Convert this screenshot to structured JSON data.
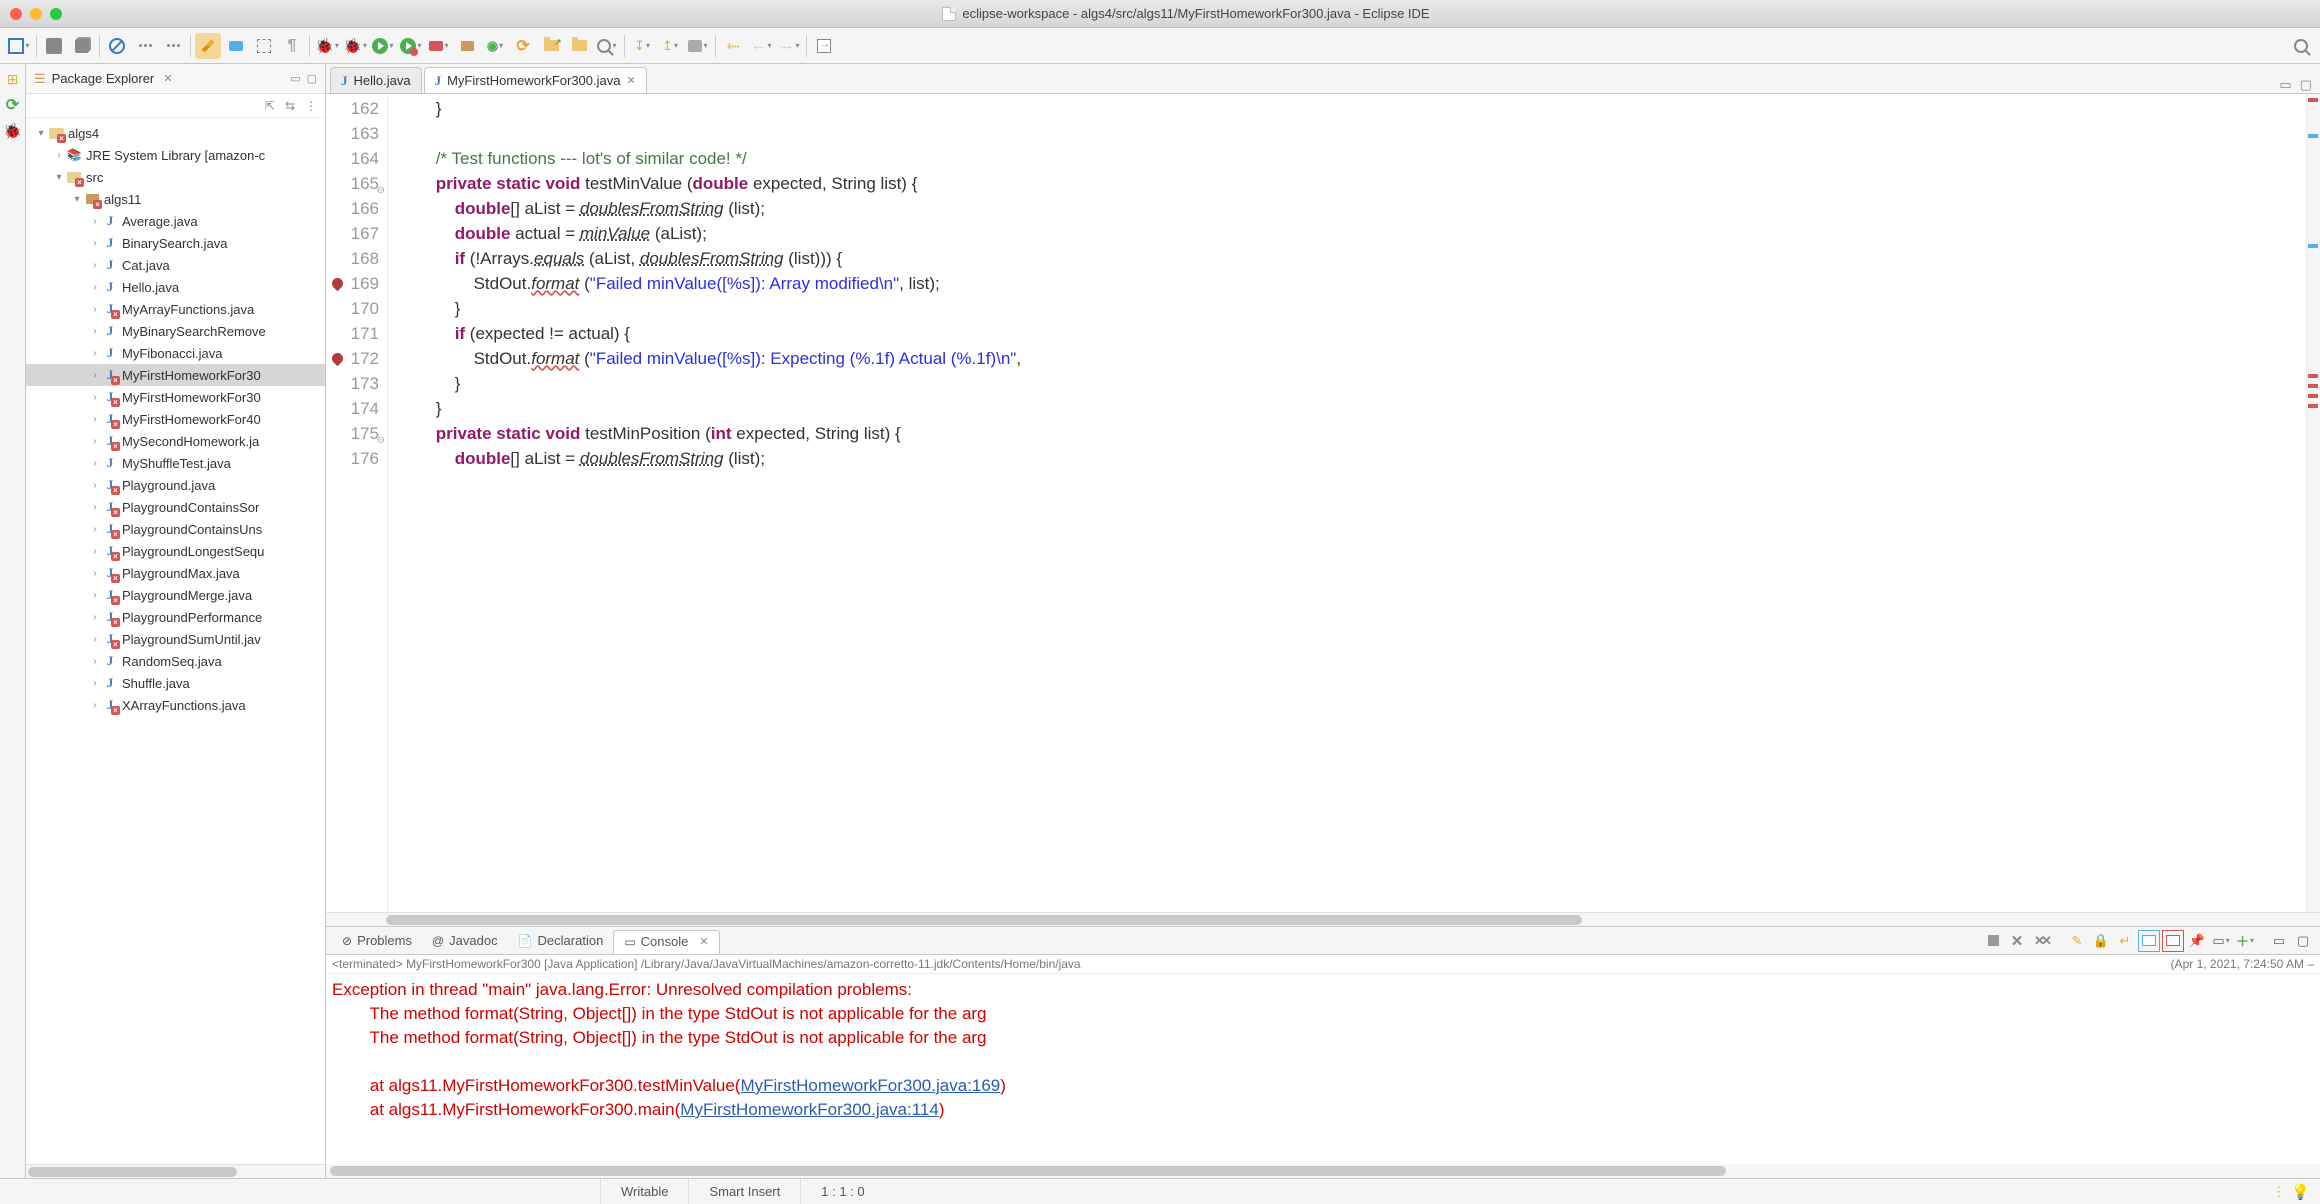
{
  "window": {
    "title": "eclipse-workspace - algs4/src/algs11/MyFirstHomeworkFor300.java - Eclipse IDE"
  },
  "pkg_explorer": {
    "title": "Package Explorer",
    "project": "algs4",
    "jre": "JRE System Library [amazon-c",
    "src": "src",
    "package": "algs11",
    "files": [
      "Average.java",
      "BinarySearch.java",
      "Cat.java",
      "Hello.java",
      "MyArrayFunctions.java",
      "MyBinarySearchRemove",
      "MyFibonacci.java",
      "MyFirstHomeworkFor30",
      "MyFirstHomeworkFor30",
      "MyFirstHomeworkFor40",
      "MySecondHomework.ja",
      "MyShuffleTest.java",
      "Playground.java",
      "PlaygroundContainsSor",
      "PlaygroundContainsUns",
      "PlaygroundLongestSequ",
      "PlaygroundMax.java",
      "PlaygroundMerge.java",
      "PlaygroundPerformance",
      "PlaygroundSumUntil.jav",
      "RandomSeq.java",
      "Shuffle.java",
      "XArrayFunctions.java"
    ],
    "selected_index": 7
  },
  "editor": {
    "tabs": [
      {
        "name": "Hello.java",
        "active": false
      },
      {
        "name": "MyFirstHomeworkFor300.java",
        "active": true
      }
    ],
    "first_line_no": 162,
    "breakpoints": [
      169,
      172
    ],
    "collapse_marks": [
      165,
      175
    ],
    "code_lines": [
      {
        "raw": "        }"
      },
      {
        "raw": ""
      },
      {
        "raw": "        /* Test functions --- lot's of similar code! */",
        "cls": "cm"
      },
      {
        "tokens": [
          {
            "t": "        "
          },
          {
            "t": "private",
            "c": "kw"
          },
          {
            "t": " "
          },
          {
            "t": "static",
            "c": "kw"
          },
          {
            "t": " "
          },
          {
            "t": "void",
            "c": "kw"
          },
          {
            "t": " testMinValue ("
          },
          {
            "t": "double",
            "c": "kw"
          },
          {
            "t": " expected, String list) {"
          }
        ]
      },
      {
        "tokens": [
          {
            "t": "            "
          },
          {
            "t": "double",
            "c": "kw"
          },
          {
            "t": "[] aList = "
          },
          {
            "t": "doublesFromString",
            "c": "fn-u"
          },
          {
            "t": " (list);"
          }
        ]
      },
      {
        "tokens": [
          {
            "t": "            "
          },
          {
            "t": "double",
            "c": "kw"
          },
          {
            "t": " actual = "
          },
          {
            "t": "minValue",
            "c": "fn-u"
          },
          {
            "t": " (aList);"
          }
        ]
      },
      {
        "tokens": [
          {
            "t": "            "
          },
          {
            "t": "if",
            "c": "kw"
          },
          {
            "t": " (!Arrays."
          },
          {
            "t": "equals",
            "c": "fn-u"
          },
          {
            "t": " (aList, "
          },
          {
            "t": "doublesFromString",
            "c": "fn-u"
          },
          {
            "t": " (list))) {"
          }
        ]
      },
      {
        "tokens": [
          {
            "t": "                StdOut."
          },
          {
            "t": "format",
            "c": "fn-u squiggle"
          },
          {
            "t": " ("
          },
          {
            "t": "\"Failed minValue([%s]): Array modified\\n\"",
            "c": "str"
          },
          {
            "t": ", list);"
          }
        ]
      },
      {
        "raw": "            }"
      },
      {
        "tokens": [
          {
            "t": "            "
          },
          {
            "t": "if",
            "c": "kw"
          },
          {
            "t": " (expected != actual) {"
          }
        ]
      },
      {
        "tokens": [
          {
            "t": "                StdOut."
          },
          {
            "t": "format",
            "c": "fn-u squiggle"
          },
          {
            "t": " ("
          },
          {
            "t": "\"Failed minValue([%s]): Expecting (%.1f) Actual (%.1f)\\n\"",
            "c": "str"
          },
          {
            "t": ","
          }
        ]
      },
      {
        "raw": "            }"
      },
      {
        "raw": "        }"
      },
      {
        "tokens": [
          {
            "t": "        "
          },
          {
            "t": "private",
            "c": "kw"
          },
          {
            "t": " "
          },
          {
            "t": "static",
            "c": "kw"
          },
          {
            "t": " "
          },
          {
            "t": "void",
            "c": "kw"
          },
          {
            "t": " testMinPosition ("
          },
          {
            "t": "int",
            "c": "kw"
          },
          {
            "t": " expected, String list) {"
          }
        ]
      },
      {
        "tokens": [
          {
            "t": "            "
          },
          {
            "t": "double",
            "c": "kw"
          },
          {
            "t": "[] aList = "
          },
          {
            "t": "doublesFromString",
            "c": "fn-u"
          },
          {
            "t": " (list);"
          }
        ]
      }
    ]
  },
  "console": {
    "tabs": [
      {
        "name": "Problems",
        "icon": "⊘"
      },
      {
        "name": "Javadoc",
        "icon": "@"
      },
      {
        "name": "Declaration",
        "icon": "📄"
      },
      {
        "name": "Console",
        "icon": "▭",
        "active": true
      }
    ],
    "meta_prefix": "<terminated>",
    "meta_app": "MyFirstHomeworkFor300 [Java Application]",
    "meta_path": "/Library/Java/JavaVirtualMachines/amazon-corretto-11.jdk/Contents/Home/bin/java",
    "meta_ts": "(Apr 1, 2021, 7:24:50 AM –",
    "lines": [
      {
        "text": "Exception in thread \"main\" java.lang.Error: Unresolved compilation problems: ",
        "cls": "cerr"
      },
      {
        "text": "        The method format(String, Object[]) in the type StdOut is not applicable for the arg",
        "cls": "cerr"
      },
      {
        "text": "        The method format(String, Object[]) in the type StdOut is not applicable for the arg",
        "cls": "cerr"
      },
      {
        "text": "",
        "cls": "cerr"
      },
      {
        "pre": "        at algs11.MyFirstHomeworkFor300.testMinValue(",
        "link": "MyFirstHomeworkFor300.java:169",
        "post": ")"
      },
      {
        "pre": "        at algs11.MyFirstHomeworkFor300.main(",
        "link": "MyFirstHomeworkFor300.java:114",
        "post": ")"
      }
    ]
  },
  "status": {
    "writable": "Writable",
    "insert": "Smart Insert",
    "pos": "1 : 1 : 0"
  }
}
